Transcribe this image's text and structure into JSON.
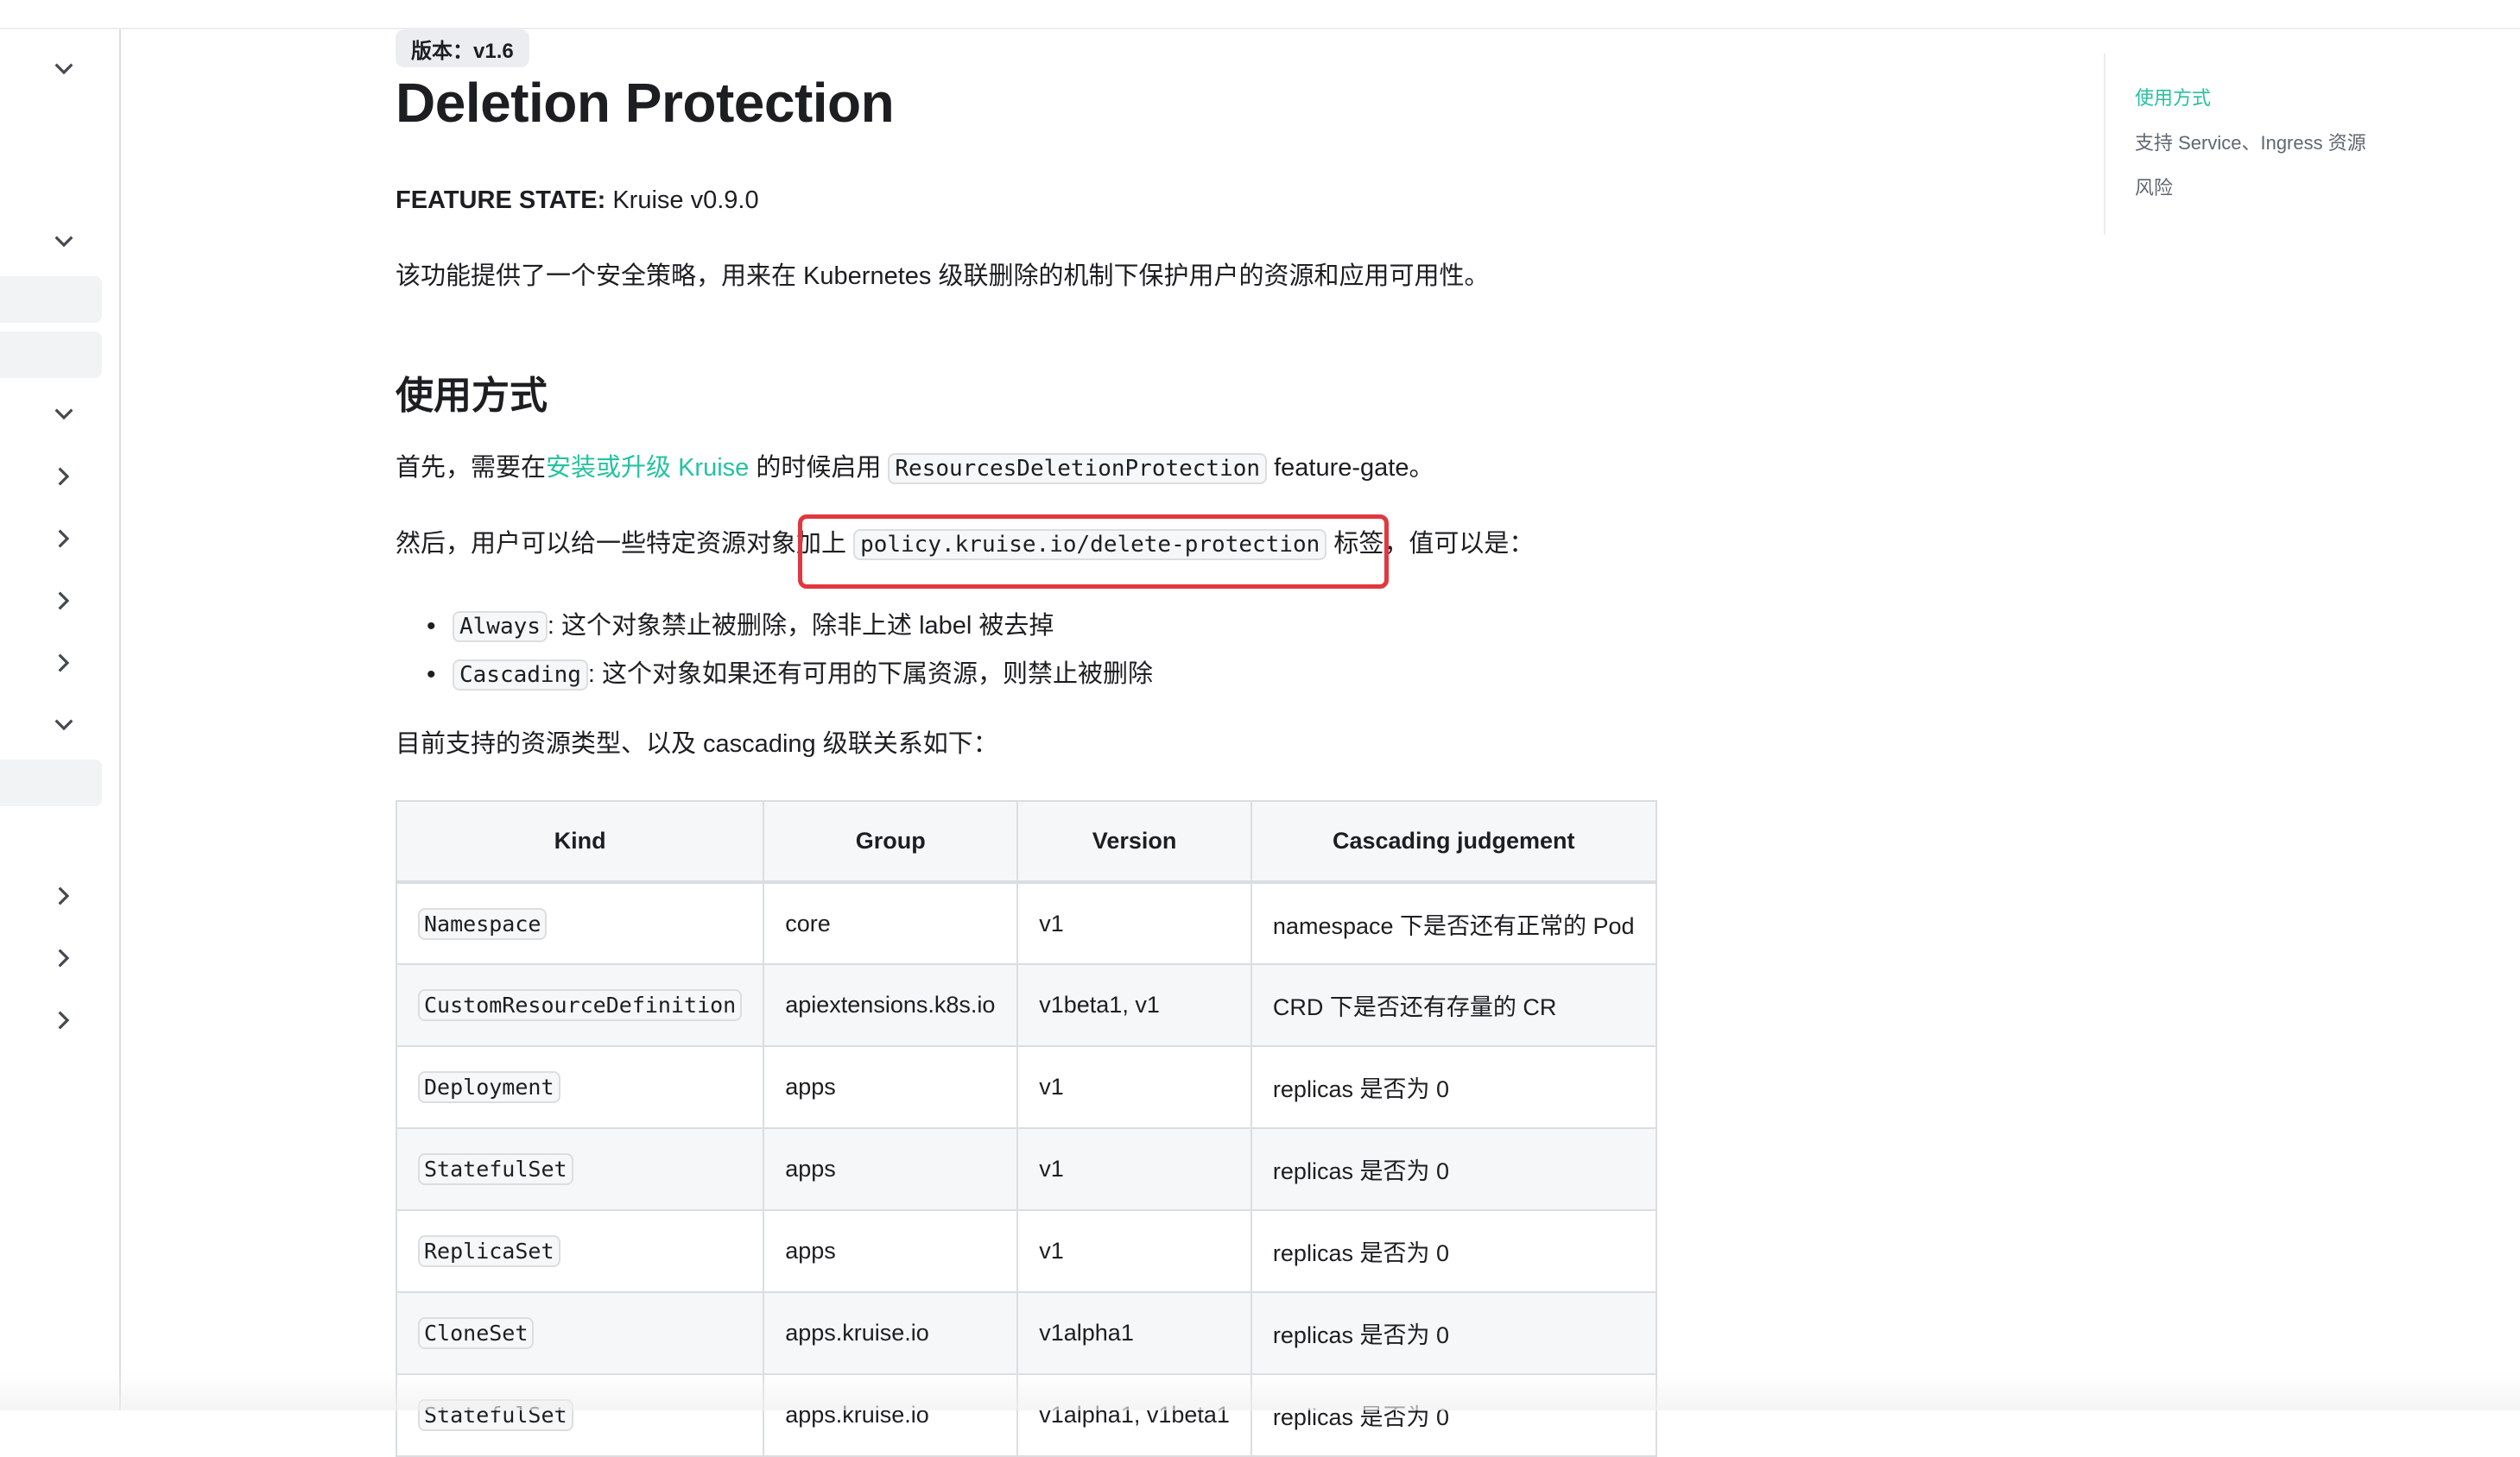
{
  "sidebar": {
    "icons": [
      {
        "name": "chevron-down-icon"
      },
      {
        "name": "chevron-down-icon"
      },
      {
        "name": "chevron-down-icon"
      },
      {
        "name": "chevron-right-icon"
      },
      {
        "name": "chevron-right-icon"
      },
      {
        "name": "chevron-right-icon"
      },
      {
        "name": "chevron-right-icon"
      },
      {
        "name": "chevron-down-icon"
      },
      {
        "name": "chevron-right-icon"
      },
      {
        "name": "chevron-right-icon"
      },
      {
        "name": "chevron-right-icon"
      }
    ]
  },
  "doc": {
    "version_badge": "版本：v1.6",
    "title": "Deletion Protection",
    "feature_state_label": "FEATURE STATE:",
    "feature_state_value": " Kruise v0.9.0",
    "intro": "该功能提供了一个安全策略，用来在 Kubernetes 级联删除的机制下保护用户的资源和应用可用性。",
    "section_usage": "使用方式",
    "p1_before": "首先，需要在",
    "p1_link": "安装或升级 Kruise",
    "p1_middle": " 的时候启用 ",
    "p1_code": "ResourcesDeletionProtection",
    "p1_after": " feature-gate。",
    "p2_before": "然后，用户可以给一些特定资源对象加上 ",
    "p2_code": "policy.kruise.io/delete-protection",
    "p2_after": " 标签，值可以是：",
    "bullets": [
      {
        "code": "Always",
        "text": ": 这个对象禁止被删除，除非上述 label 被去掉"
      },
      {
        "code": "Cascading",
        "text": ": 这个对象如果还有可用的下属资源，则禁止被删除"
      }
    ],
    "p3": "目前支持的资源类型、以及 cascading 级联关系如下："
  },
  "table": {
    "headers": [
      "Kind",
      "Group",
      "Version",
      "Cascading judgement"
    ],
    "rows": [
      [
        "Namespace",
        "core",
        "v1",
        "namespace 下是否还有正常的 Pod"
      ],
      [
        "CustomResourceDefinition",
        "apiextensions.k8s.io",
        "v1beta1, v1",
        "CRD 下是否还有存量的 CR"
      ],
      [
        "Deployment",
        "apps",
        "v1",
        "replicas 是否为 0"
      ],
      [
        "StatefulSet",
        "apps",
        "v1",
        "replicas 是否为 0"
      ],
      [
        "ReplicaSet",
        "apps",
        "v1",
        "replicas 是否为 0"
      ],
      [
        "CloneSet",
        "apps.kruise.io",
        "v1alpha1",
        "replicas 是否为 0"
      ],
      [
        "StatefulSet",
        "apps.kruise.io",
        "v1alpha1, v1beta1",
        "replicas 是否为 0"
      ]
    ]
  },
  "toc": {
    "items": [
      "使用方式",
      "支持 Service、Ingress 资源",
      "风险"
    ]
  },
  "colors": {
    "link": "#25c2a0",
    "highlight": "#e0383e"
  }
}
